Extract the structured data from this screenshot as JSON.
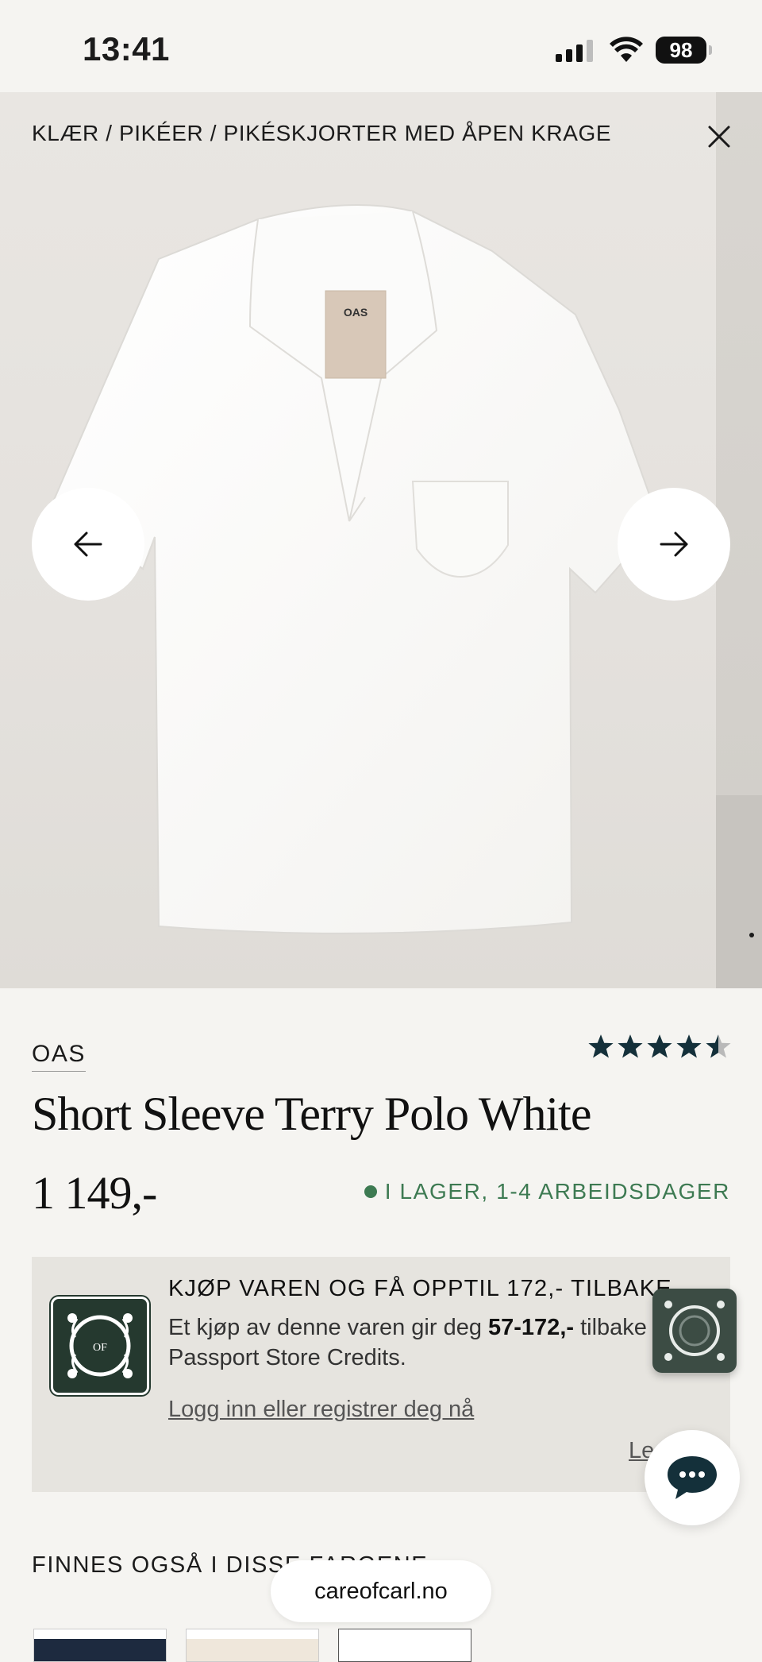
{
  "status_bar": {
    "time": "13:41",
    "battery": "98"
  },
  "gallery": {
    "breadcrumb": "KLÆR / PIKÉER / PIKÉSKJORTER MED ÅPEN KRAGE",
    "label_brand": "OAS"
  },
  "product": {
    "brand": "OAS",
    "rating": 4.5,
    "title": "Short Sleeve Terry Polo White",
    "price": "1 149,-",
    "stock": "I LAGER, 1-4 ARBEIDSDAGER"
  },
  "promo": {
    "heading": "KJØP VAREN OG FÅ OPPTIL 172,- TILBAKE",
    "body_before": "Et kjøp av denne varen gir deg ",
    "body_amount": "57-172,-",
    "body_after": " tilbake i Passport Store Credits.",
    "link": "Logg inn eller registrer deg nå",
    "more": "Les mer",
    "logo_text": "OF"
  },
  "colors": {
    "label": "FINNES OGSÅ I DISSE FARGENE"
  },
  "browser": {
    "url": "careofcarl.no"
  },
  "theme": {
    "accent_green": "#3d7a52",
    "dark_green": "#25392f",
    "star": "#14303a"
  }
}
